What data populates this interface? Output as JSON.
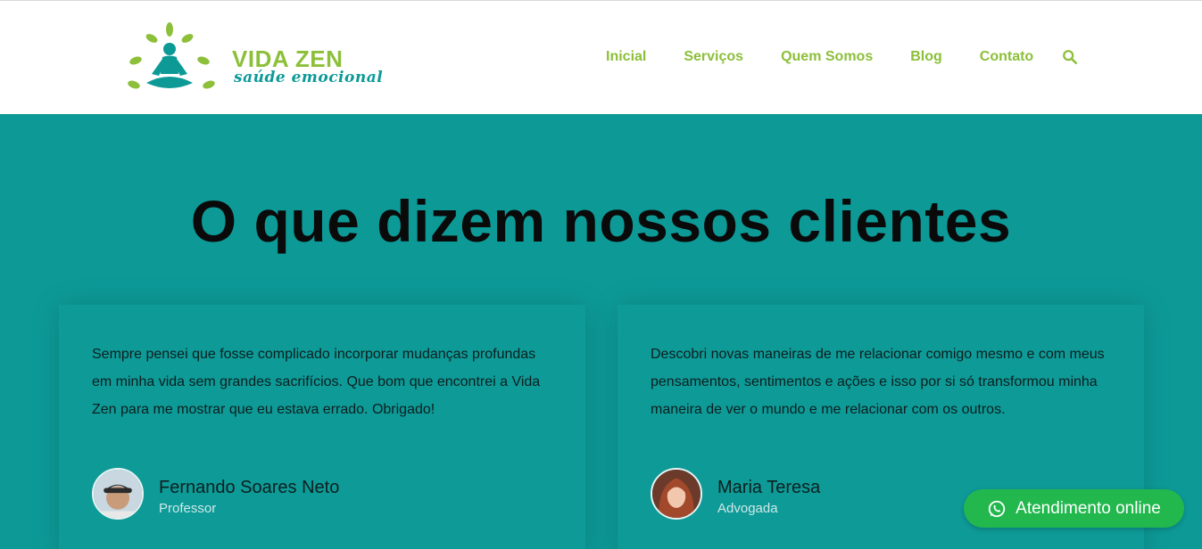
{
  "brand": {
    "name": "VIDA ZEN",
    "tagline": "saúde emocional"
  },
  "nav": {
    "items": [
      "Inicial",
      "Serviços",
      "Quem Somos",
      "Blog",
      "Contato"
    ],
    "search_icon": "search-icon"
  },
  "section": {
    "title": "O que dizem nossos clientes"
  },
  "testimonials": [
    {
      "quote": "Sempre pensei que fosse complicado incorporar mudanças profundas em minha vida sem grandes sacrifícios. Que bom que encontrei a Vida Zen para me mostrar que eu estava errado. Obrigado!",
      "name": "Fernando Soares Neto",
      "role": "Professor"
    },
    {
      "quote": "Descobri novas maneiras de me relacionar comigo mesmo e com meus pensamentos, sentimentos e ações e isso por si só transformou minha maneira de ver o mundo e me relacionar com os outros.",
      "name": "Maria Teresa",
      "role": "Advogada"
    }
  ],
  "chat": {
    "label": "Atendimento online",
    "icon": "whatsapp-icon"
  },
  "colors": {
    "teal": "#0d9a97",
    "green": "#8cbf3a",
    "whatsapp": "#22b84e"
  }
}
